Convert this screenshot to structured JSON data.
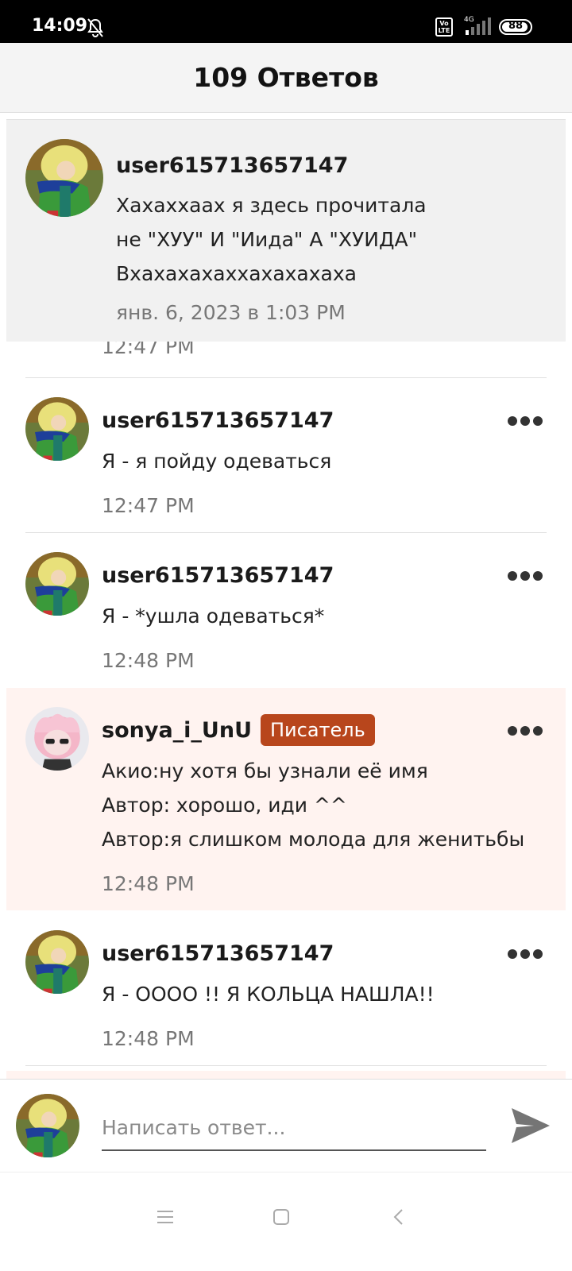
{
  "status_bar": {
    "time": "14:09",
    "network": "4G",
    "volte": "Vo LTE",
    "battery": "88"
  },
  "header": {
    "title": "109 Ответов"
  },
  "parent_comment": {
    "username": "user615713657147",
    "lines": [
      "Хахаххаах я здесь прочитала",
      "не \"ХУУ\" И \"Иида\" А \"ХУИДА\"",
      "Вхахахахаххахахахаха"
    ],
    "time": "янв. 6, 2023 в 1:03 PM"
  },
  "ghost_time": "12:47 PM",
  "comments": [
    {
      "username": "user615713657147",
      "lines": [
        "Я - я пойду одеваться"
      ],
      "time": "12:47 PM"
    },
    {
      "username": "user615713657147",
      "lines": [
        "Я - *ушла одеваться*"
      ],
      "time": "12:48 PM"
    },
    {
      "username": "sonya_i_UnU",
      "badge": "Писатель",
      "lines": [
        "Акио:ну хотя бы узнали её имя",
        "Автор: хорошо, иди ^^",
        "Автор:я слишком молода для женитьбы"
      ],
      "time": "12:48 PM"
    },
    {
      "username": "user615713657147",
      "lines": [
        "Я - ОООО !! Я КОЛЬЦА НАШЛА!!"
      ],
      "time": "12:48 PM"
    }
  ],
  "reply": {
    "placeholder": "Написать ответ..."
  },
  "colors": {
    "badge": "#b8461c",
    "highlight": "#fff3f0",
    "header_bg": "#f4f4f4"
  },
  "icons": [
    "notifications-off-icon",
    "signal-icon",
    "battery-icon",
    "more-icon",
    "send-icon",
    "menu-icon",
    "home-icon",
    "back-icon"
  ]
}
